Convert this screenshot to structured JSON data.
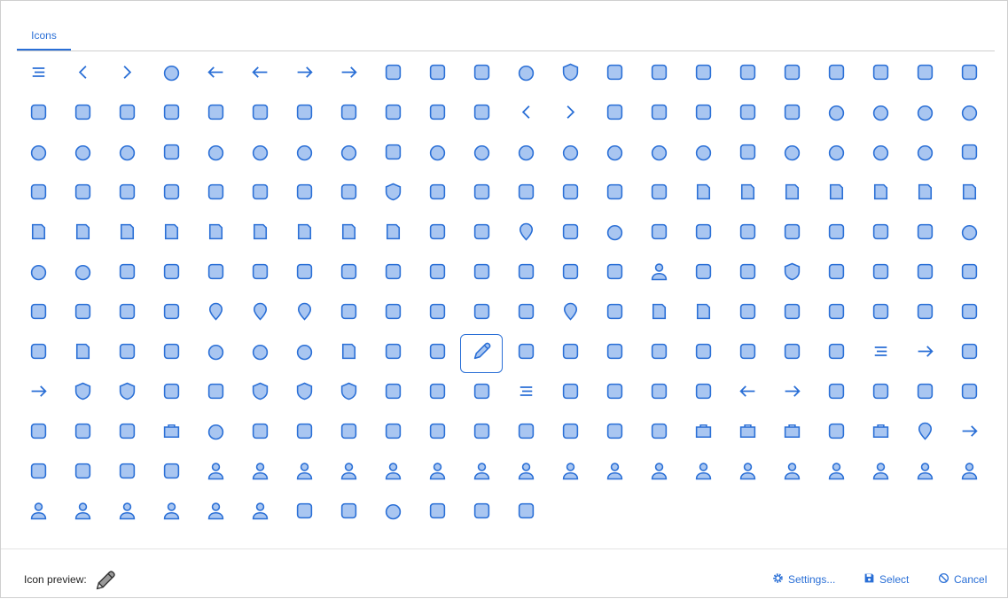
{
  "tabs": [
    {
      "label": "Icons"
    }
  ],
  "icon_names": [
    "menu-lines-icon",
    "chevron-left-icon",
    "chevron-right-icon",
    "apple-icon",
    "arrow-left-icon",
    "arrow-left-long-icon",
    "arrow-right-icon",
    "arrow-right-long-icon",
    "undo-icon",
    "repeat-icon",
    "refresh-icon",
    "atom-icon",
    "badge-check-icon",
    "bacteria-icon",
    "checklist-icon",
    "barcode-icon",
    "beer-mug-icon",
    "bell-ringing-icon",
    "bell-snooze-icon",
    "book-icon",
    "book-upload-icon",
    "book-a-icon",
    "book-open-icon",
    "book-star-icon",
    "books-icon",
    "archive-box-icon",
    "window-icon",
    "building-icon",
    "calendar-icon",
    "calendar-edit-icon",
    "camera-sync-icon",
    "cards-icon",
    "caret-down-icon",
    "caret-left-icon",
    "caret-right-icon",
    "starburst-icon",
    "line-chart-icon",
    "pie-chart-icon",
    "pie-chart-quarter-icon",
    "check-icon",
    "circle-icon",
    "play-circle-icon",
    "chevron-down-circle-icon",
    "download-circle-icon",
    "alert-circle-icon",
    "info-circle-icon",
    "minus-circle-icon",
    "share-nodes-icon",
    "ring-circle-icon",
    "plus-circle-icon",
    "arrow-up-circle-icon",
    "circles-overlap-icon",
    "city-icon",
    "clock-icon",
    "clock-alt-icon",
    "clock-half-icon",
    "cloud-check-icon",
    "cloud-alert-icon",
    "cloud-sun-icon",
    "cloud-icon",
    "git-branch-icon",
    "chat-bubble-icon",
    "chat-arrow-icon",
    "chat-check-icon",
    "chat-text-icon",
    "sms-icon",
    "database-icon",
    "diagram-icon",
    "cube-icon",
    "desktop-settings-icon",
    "dollar-icon",
    "door-icon",
    "vector-square-icon",
    "eject-icon",
    "mail-badge-icon",
    "mail-open-icon",
    "money-mail-icon",
    "euro-icon",
    "eye-icon",
    "eye-off-icon",
    "family-icon",
    "document-check-icon",
    "document-alert-icon",
    "document-info-icon",
    "document-error-icon",
    "document-code-icon",
    "document-chart-icon",
    "document-excel-icon",
    "document-warning-icon",
    "document-arrow-icon",
    "document-text-icon",
    "document-minus-icon",
    "document-pdf-icon",
    "document-edit-icon",
    "document-table-icon",
    "document-image-icon",
    "document-word-icon",
    "filter-icon",
    "filter-clear-icon",
    "drop-icon",
    "flag-icon",
    "football-icon",
    "folder-download-icon",
    "folder-upload-icon",
    "folder-open-icon",
    "folder-error-icon",
    "fast-forward-icon",
    "skip-forward-icon",
    "frame-icon",
    "gauge-icon",
    "gear-icon",
    "gear-alt-icon",
    "grid-dots-icon",
    "grid-dots-small-icon",
    "hand-point-down-icon",
    "hand-point-left-icon",
    "hand-raised-icon",
    "hand-point-right-icon",
    "hand-pointing-icon",
    "hand-point-up-icon",
    "hand-wave-icon",
    "home-icon",
    "home-alt-icon",
    "home-filled-icon",
    "home-person-icon",
    "home-flag-icon",
    "home-health-icon",
    "id-badge-icon",
    "layers-icon",
    "key-icon",
    "key-alt-icon",
    "keyboard-icon",
    "laptop-icon",
    "arrows-swap-icon",
    "lamp-icon",
    "lightbulb-icon",
    "pin-minus-icon",
    "location-pin-icon",
    "pin-plus-icon",
    "lock-icon",
    "lock-hash-icon",
    "lock-closed-icon",
    "lock-open-icon",
    "search-icon",
    "map-pin-icon",
    "medicine-icon",
    "memo-icon",
    "receipt-icon",
    "message-icon",
    "message-alert-icon",
    "message-text-icon",
    "message-bubble-icon",
    "message-plus-icon",
    "mountain-icon",
    "mug-icon",
    "note-plus-icon",
    "crop-icon",
    "selection-icon",
    "octagon-icon",
    "octagon-check-icon",
    "octagon-x-icon",
    "page-icon",
    "send-icon",
    "paperclip-icon",
    "pencil-icon",
    "pedestrian-icon",
    "phone-outgoing-icon",
    "phone-hangup-icon",
    "phone-add-icon",
    "airplane-icon",
    "play-icon",
    "plus-icon",
    "puzzle-icon",
    "stack-icon",
    "sign-out-icon",
    "arrows-exchange-icon",
    "sign-in-icon",
    "shield-badge-icon",
    "badge-question-icon",
    "copy-icon",
    "share-arrow-icon",
    "shield-icon",
    "shield-half-icon",
    "shield-cross-icon",
    "footprints-icon",
    "signpost-icon",
    "org-chart-icon",
    "slider-icon",
    "sparkle-icon",
    "square-icon",
    "square-a-icon",
    "square-arrow-down-right-icon",
    "square-arrow-left-icon",
    "square-arrow-right-icon",
    "square-list-icon",
    "square-text-icon",
    "square-cross-box-icon",
    "square-x-icon",
    "square-x-alt-icon",
    "star-icon",
    "asterisk-icon",
    "suitcase-icon",
    "sun-gear-icon",
    "table-icon",
    "table-grid-icon",
    "table-lock-icon",
    "table-grid-lock-icon",
    "table-column-icon",
    "tablet-code-icon",
    "tablet-icon",
    "thumbs-up-icon",
    "tree-icon",
    "toggle-icon",
    "trash-upload-icon",
    "trash-icon",
    "trash-restore-icon",
    "warning-icon",
    "truck-arrow-icon",
    "truck-drop-icon",
    "turn-right-icon",
    "turn-down-icon",
    "turn-up-icon",
    "unlock-icon",
    "lock-minus-icon",
    "person-icon",
    "person-clock-icon",
    "person-suit-icon",
    "people-icon",
    "people-pair-icon",
    "person-long-hair-icon",
    "person-headset-icon",
    "person-helmet-icon",
    "person-lock-icon",
    "person-search-icon",
    "person-edit-icon",
    "person-officer-icon",
    "person-add-icon",
    "person-police-icon",
    "person-shield-icon",
    "person-off-icon",
    "person-tag-icon",
    "person-tie-icon",
    "person-bow-icon",
    "person-alt-icon",
    "person-remove-icon",
    "team-icon",
    "team-settings-icon",
    "group-icon",
    "contact-card-icon",
    "video-icon",
    "volleyball-icon",
    "credit-cards-icon",
    "wrench-icon",
    "wrench-alt-icon"
  ],
  "selected_icon": "pencil-icon",
  "footer": {
    "preview_label": "Icon preview:",
    "settings_label": "Settings...",
    "select_label": "Select",
    "cancel_label": "Cancel"
  },
  "colors": {
    "accent": "#2a6fd6",
    "icon_fill": "#a9c6f1",
    "icon_stroke": "#2a6fd6"
  }
}
